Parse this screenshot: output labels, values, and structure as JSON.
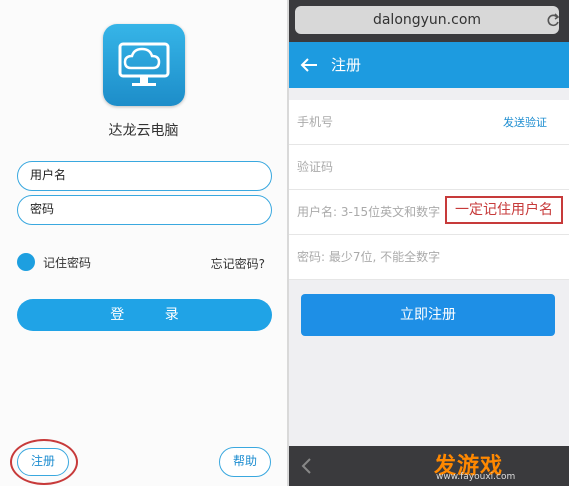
{
  "left": {
    "app_name": "达龙云电脑",
    "username_placeholder": "用户名",
    "password_placeholder": "密码",
    "remember_label": "记住密码",
    "forgot_label": "忘记密码?",
    "login_label": "登 录",
    "register_label": "注册",
    "help_label": "帮助"
  },
  "right": {
    "url": "dalongyun.com",
    "nav_title": "注册",
    "phone_label": "手机号",
    "send_code_label": "发送验证",
    "code_label": "验证码",
    "username_hint": "用户名: 3-15位英文和数字",
    "annotation": "一定记住用户名",
    "password_hint": "密码: 最少7位, 不能全数字",
    "submit_label": "立即注册",
    "watermark_logo": "发游戏",
    "watermark_url": "www.fayouxi.com"
  },
  "colors": {
    "accent": "#1d9be0",
    "button": "#1e8fe6",
    "annotation": "#c73a3a",
    "watermark": "#ff8800"
  }
}
